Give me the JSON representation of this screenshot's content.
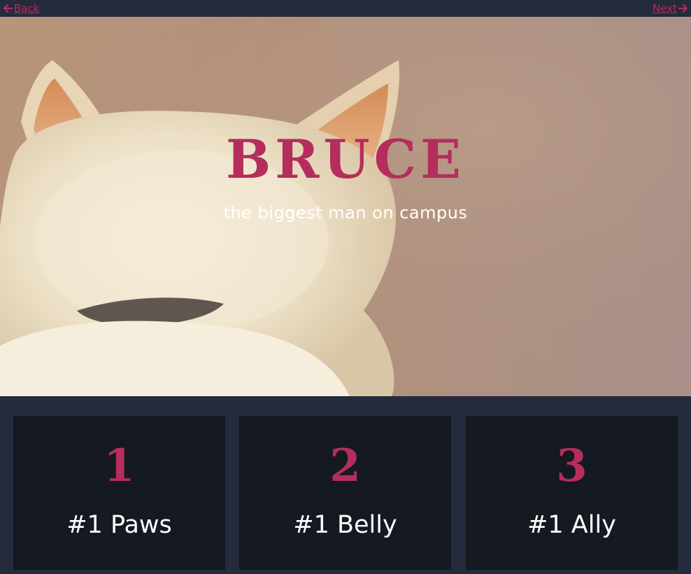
{
  "nav": {
    "back_label": "Back",
    "next_label": "Next",
    "back_icon": "arrow-left-icon",
    "next_icon": "arrow-right-icon"
  },
  "hero": {
    "title": "BRUCE",
    "subtitle": "the biggest man on campus",
    "image": "white cat seen from behind"
  },
  "cards": [
    {
      "number": "1",
      "label": "#1 Paws"
    },
    {
      "number": "2",
      "label": "#1 Belly"
    },
    {
      "number": "3",
      "label": "#1 Ally"
    }
  ],
  "colors": {
    "accent": "#b42d5c",
    "page_background": "#232b3c",
    "card_background": "#141922",
    "text_light": "#ffffff"
  }
}
